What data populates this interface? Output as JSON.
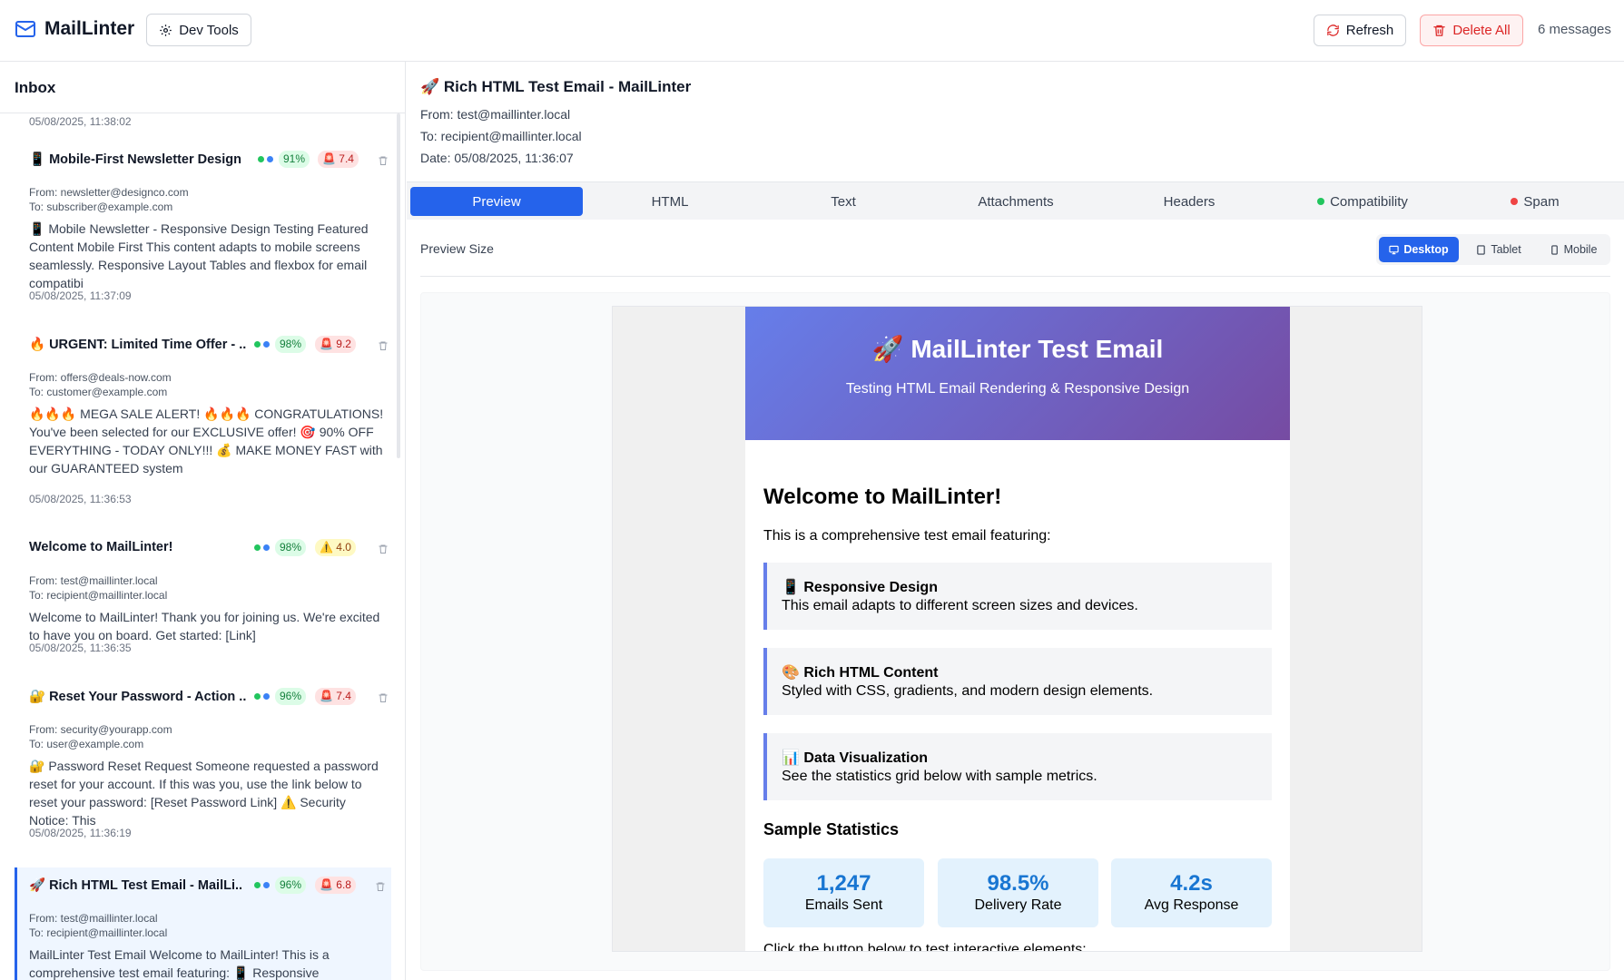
{
  "app": {
    "name": "MailLinter",
    "dev_tools_label": "Dev Tools",
    "refresh_label": "Refresh",
    "delete_all_label": "Delete All",
    "message_count": "6 messages"
  },
  "inbox": {
    "title": "Inbox",
    "top_partial_date": "05/08/2025, 11:38:02",
    "items": [
      {
        "subject": "📱 Mobile-First Newsletter Design",
        "compat": "91%",
        "spam": "🚨 7.4",
        "spam_level": "red",
        "from": "From: newsletter@designco.com",
        "to": "To: subscriber@example.com",
        "preview": "📱 Mobile Newsletter - Responsive Design Testing Featured Content Mobile First This content adapts to mobile screens seamlessly. Responsive Layout Tables and flexbox for email compatibi",
        "date": "05/08/2025, 11:37:09"
      },
      {
        "subject": "🔥 URGENT: Limited Time Offer - ...",
        "compat": "98%",
        "spam": "🚨 9.2",
        "spam_level": "red",
        "from": "From: offers@deals-now.com",
        "to": "To: customer@example.com",
        "preview": "🔥🔥🔥 MEGA SALE ALERT! 🔥🔥🔥 CONGRATULATIONS! You've been selected for our EXCLUSIVE offer! 🎯 90% OFF EVERYTHING - TODAY ONLY!!! 💰 MAKE MONEY FAST with our GUARANTEED system",
        "date": "05/08/2025, 11:36:53"
      },
      {
        "subject": "Welcome to MailLinter!",
        "compat": "98%",
        "spam": "⚠️ 4.0",
        "spam_level": "yellow",
        "from": "From: test@maillinter.local",
        "to": "To: recipient@maillinter.local",
        "preview": "Welcome to MailLinter! Thank you for joining us. We're excited to have you on board. Get started: [Link]",
        "date": "05/08/2025, 11:36:35"
      },
      {
        "subject": "🔐 Reset Your Password - Action ...",
        "compat": "96%",
        "spam": "🚨 7.4",
        "spam_level": "red",
        "from": "From: security@yourapp.com",
        "to": "To: user@example.com",
        "preview": "🔐 Password Reset Request Someone requested a password reset for your account. If this was you, use the link below to reset your password: [Reset Password Link] ⚠️ Security Notice: This",
        "date": "05/08/2025, 11:36:19"
      },
      {
        "subject": "🚀 Rich HTML Test Email - MailLi...",
        "compat": "96%",
        "spam": "🚨 6.8",
        "spam_level": "red",
        "from": "From: test@maillinter.local",
        "to": "To: recipient@maillinter.local",
        "preview": "MailLinter Test Email Welcome to MailLinter! This is a comprehensive test email featuring: 📱 Responsive",
        "date": ""
      }
    ]
  },
  "message": {
    "subject": "🚀 Rich HTML Test Email - MailLinter",
    "from": "From: test@maillinter.local",
    "to": "To: recipient@maillinter.local",
    "date": "Date: 05/08/2025, 11:36:07"
  },
  "tabs": [
    "Preview",
    "HTML",
    "Text",
    "Attachments",
    "Headers",
    "Compatibility",
    "Spam"
  ],
  "preview_size": {
    "label": "Preview Size",
    "options": [
      "Desktop",
      "Tablet",
      "Mobile"
    ],
    "selected": "Desktop"
  },
  "email": {
    "hero_title": "🚀 MailLinter Test Email",
    "hero_subtitle": "Testing HTML Email Rendering & Responsive Design",
    "welcome": "Welcome to MailLinter!",
    "intro": "This is a comprehensive test email featuring:",
    "features": [
      {
        "title": "📱 Responsive Design",
        "desc": "This email adapts to different screen sizes and devices."
      },
      {
        "title": "🎨 Rich HTML Content",
        "desc": "Styled with CSS, gradients, and modern design elements."
      },
      {
        "title": "📊 Data Visualization",
        "desc": "See the statistics grid below with sample metrics."
      }
    ],
    "stats_title": "Sample Statistics",
    "stats": [
      {
        "value": "1,247",
        "label": "Emails Sent"
      },
      {
        "value": "98.5%",
        "label": "Delivery Rate"
      },
      {
        "value": "4.2s",
        "label": "Avg Response"
      }
    ],
    "cta_text": "Click the button below to test interactive elements:"
  },
  "colors": {
    "accent": "#2563eb",
    "compat_dot": "#22c55e",
    "spam_dot": "#ef4444",
    "hero_gradient_start": "#667eea",
    "hero_gradient_end": "#764ba2",
    "stat_value": "#1976d2"
  },
  "icons": {
    "brand": "mail-icon",
    "dev_tools": "gear-icon",
    "refresh": "refresh-icon",
    "delete_all": "trash-icon",
    "item_delete": "trash-icon",
    "desktop": "monitor-icon",
    "tablet": "tablet-icon",
    "mobile": "phone-icon"
  }
}
